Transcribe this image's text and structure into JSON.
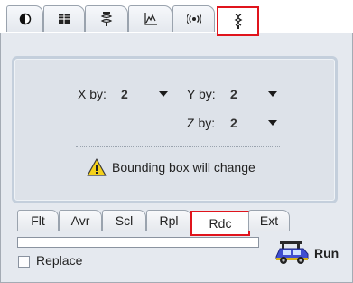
{
  "top_tabs": [
    {
      "icon": "contrast-icon"
    },
    {
      "icon": "grid-icon"
    },
    {
      "icon": "filter-tool-icon"
    },
    {
      "icon": "histogram-icon"
    },
    {
      "icon": "broadcast-icon"
    },
    {
      "icon": "resample-icon",
      "selected": true
    }
  ],
  "reduce": {
    "x_label": "X by:",
    "x_value": "2",
    "y_label": "Y by:",
    "y_value": "2",
    "z_label": "Z by:",
    "z_value": "2",
    "warning": "Bounding box will change"
  },
  "bottom_tabs": [
    "Flt",
    "Avr",
    "Scl",
    "Rpl",
    "Rdc",
    "Ext"
  ],
  "bottom_tab_selected": "Rdc",
  "progress": 0,
  "replace_label": "Replace",
  "replace_checked": false,
  "run_label": "Run",
  "colors": {
    "selected_outline": "#e0141c",
    "panel": "#e5e9ef",
    "inner_panel": "#dde2e9"
  }
}
